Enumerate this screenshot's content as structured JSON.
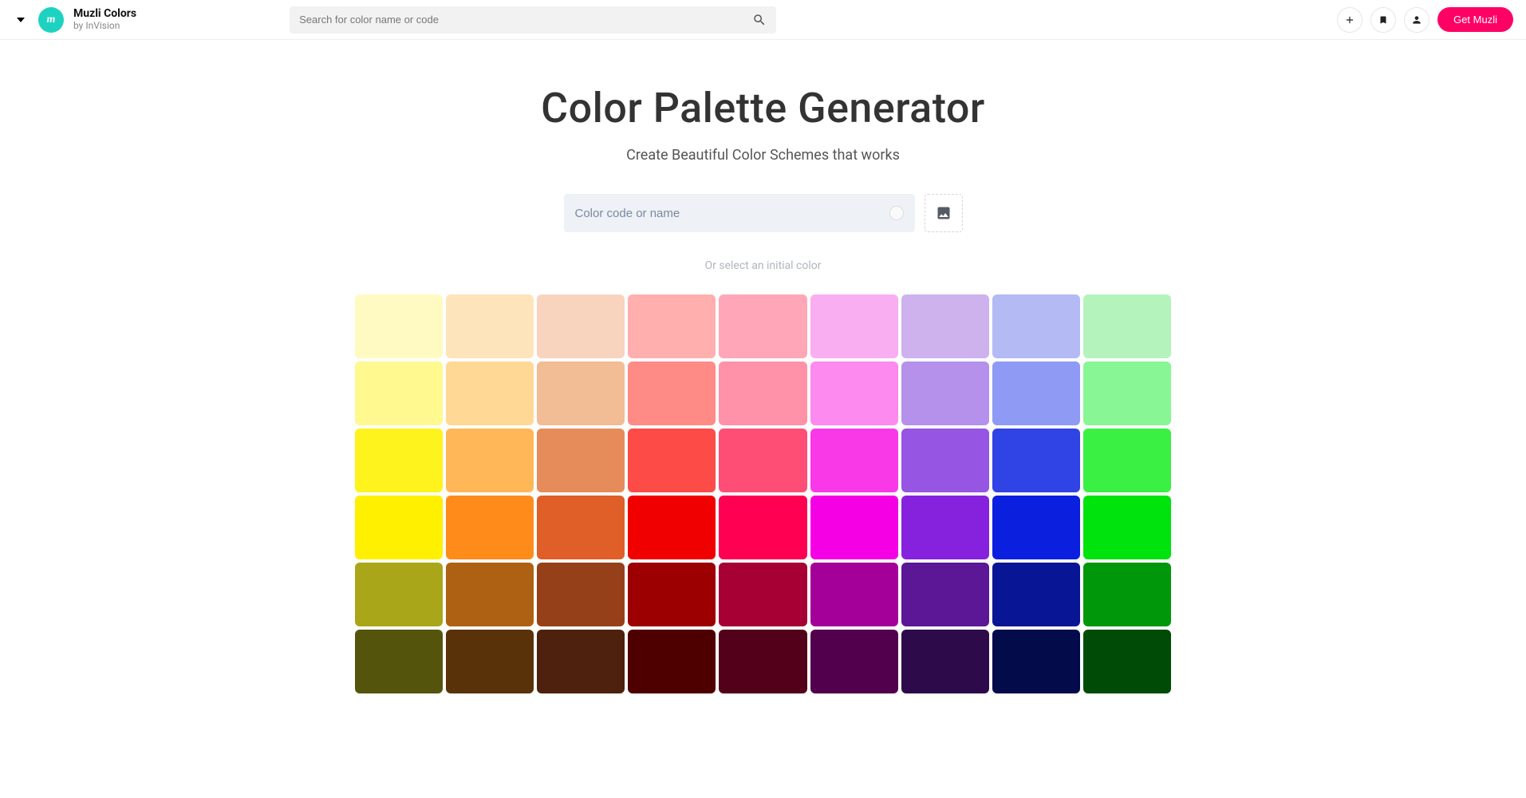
{
  "header": {
    "logo_title": "Muzli Colors",
    "logo_subtitle": "by InVision",
    "logo_glyph": "m",
    "search_placeholder": "Search for color name or code",
    "get_muzli_label": "Get Muzli"
  },
  "main": {
    "title": "Color Palette Generator",
    "subtitle": "Create Beautiful Color Schemes that works",
    "color_input_placeholder": "Color code or name",
    "hint": "Or select an initial color"
  },
  "swatches": [
    [
      "#FFFAC1",
      "#FDE4BB",
      "#F8D3BD",
      "#FFB0AE",
      "#FFA7B8",
      "#F9AEF1",
      "#CDB2EE",
      "#B3BAF4",
      "#B4F4BC"
    ],
    [
      "#FFF98F",
      "#FFD896",
      "#F2BC95",
      "#FF8B86",
      "#FF91A9",
      "#FC8AEF",
      "#B591EB",
      "#8E9AF3",
      "#88F694"
    ],
    [
      "#FFF31E",
      "#FFB758",
      "#E68C5B",
      "#FD4B48",
      "#FF4E76",
      "#F938E8",
      "#9655E3",
      "#3043E5",
      "#3AF043"
    ],
    [
      "#FFF000",
      "#FF8B1A",
      "#E05E27",
      "#F10000",
      "#FF0052",
      "#F500E5",
      "#8622DE",
      "#0B1FDF",
      "#00E30D"
    ],
    [
      "#A9A61A",
      "#AE6113",
      "#96401A",
      "#9C0000",
      "#A60035",
      "#A40099",
      "#5B1796",
      "#081695",
      "#00970A"
    ],
    [
      "#55540D",
      "#5A3209",
      "#4D210D",
      "#4E0000",
      "#53001A",
      "#52004D",
      "#2D0B4B",
      "#040B4B",
      "#004B05"
    ]
  ]
}
